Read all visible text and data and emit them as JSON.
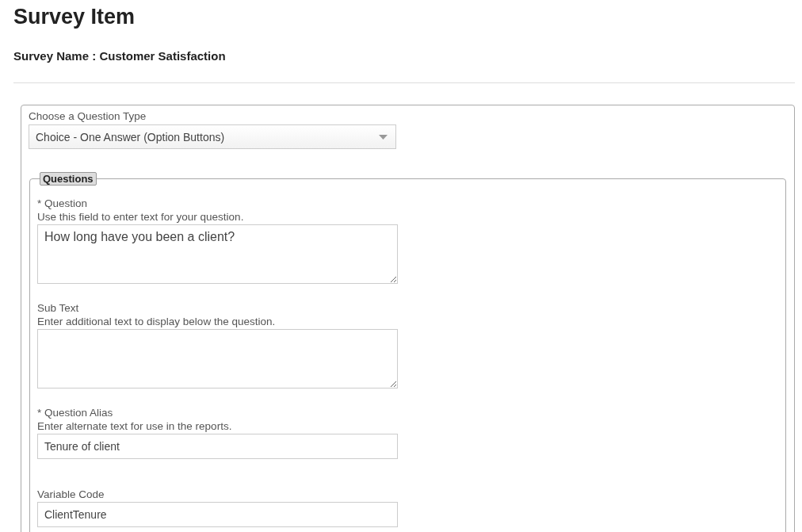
{
  "page": {
    "title": "Survey Item",
    "subtitle": "Survey Name : Customer Satisfaction"
  },
  "question_type": {
    "label": "Choose a Question Type",
    "value": "Choice - One Answer (Option Buttons)"
  },
  "questions": {
    "legend": "Questions",
    "fields": [
      {
        "kind": "textarea",
        "label": "* Question",
        "hint": "Use this field to enter text for your question.",
        "value": "How long have you been a client?"
      },
      {
        "kind": "textarea",
        "label": "Sub Text",
        "hint": "Enter additional text to display below the question."
      },
      {
        "kind": "input",
        "label": "* Question Alias",
        "hint": "Enter alternate text for use in the reports.",
        "value": "Tenure of client"
      },
      {
        "kind": "input",
        "label": "Variable Code",
        "value": "ClientTenure"
      }
    ]
  }
}
